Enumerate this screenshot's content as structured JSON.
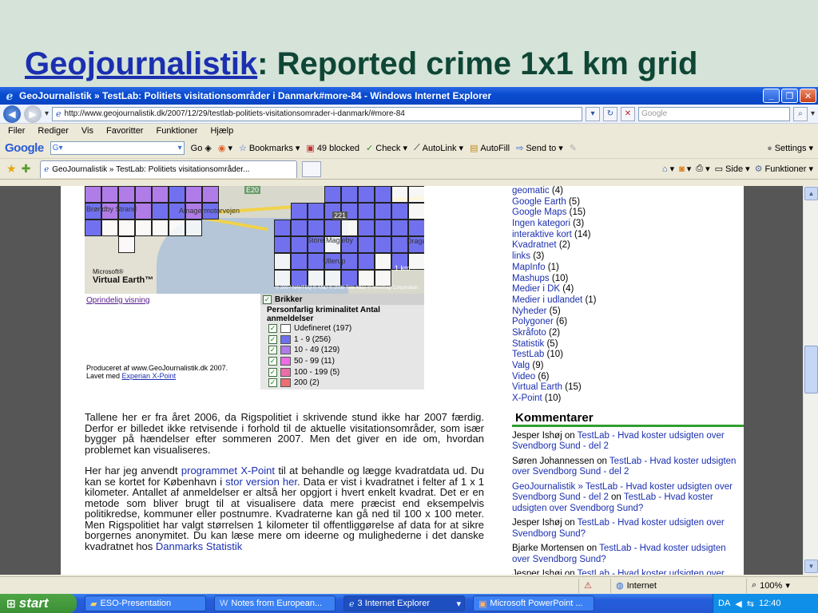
{
  "slide": {
    "title_link": "Geojournalistik",
    "title_rest": ": Reported crime 1x1 km grid"
  },
  "window": {
    "title": "GeoJournalistik » TestLab: Politiets visitationsområder i Danmark#more-84 - Windows Internet Explorer",
    "url": "http://www.geojournalistik.dk/2007/12/29/testlab-politiets-visitationsomrader-i-danmark/#more-84",
    "search_placeholder": "Google",
    "menu": [
      "Filer",
      "Rediger",
      "Vis",
      "Favoritter",
      "Funktioner",
      "Hjælp"
    ],
    "googlebar": {
      "logo": "Google",
      "go": "Go",
      "bookmarks": "Bookmarks",
      "blocked": "49 blocked",
      "check": "Check",
      "autolink": "AutoLink",
      "autofill": "AutoFill",
      "sendto": "Send to",
      "settings": "Settings"
    },
    "tab_label": "GeoJournalistik » TestLab: Politiets visitationsområder...",
    "toolbar": {
      "side": "Side",
      "funktioner": "Funktioner"
    },
    "status": {
      "zone": "Internet",
      "zoom": "100%"
    }
  },
  "map": {
    "labels": [
      "Brøndby Strand",
      "Amagermotorvejen",
      "Store Magleby",
      "Dragør",
      "Ullerup",
      "E20",
      "221"
    ],
    "brand_small": "Microsoft®",
    "brand": "Virtual Earth™",
    "copyright": "© 2007 NAVTEQ  © AND  © 2006 Tele Atlas  © Intermap Corporation",
    "scale": "1 km",
    "original_view": "Oprindelig visning",
    "legend_head": "Brikker",
    "legend_sub": "Personfarlig kriminalitet Antal anmeldelser",
    "legend_rows": [
      {
        "label": "Udefineret (197)",
        "color": "#ffffff"
      },
      {
        "label": "1 - 9 (256)",
        "color": "#6f6ff0"
      },
      {
        "label": "10 - 49 (129)",
        "color": "#b07ce8"
      },
      {
        "label": "50 - 99 (11)",
        "color": "#ee6ce8"
      },
      {
        "label": "100 - 199 (5)",
        "color": "#ec6ea8"
      },
      {
        "label": "200 (2)",
        "color": "#ec6e6e"
      }
    ],
    "produced_1": "Produceret af www.GeoJournalistik.dk 2007.",
    "produced_2": "Lavet med ",
    "produced_link": "Experian X-Point"
  },
  "article": {
    "p1": "Tallene her er fra året 2006, da Rigspolitiet i skrivende stund ikke har 2007 færdig. Derfor er billedet ikke retvisende i forhold til de aktuelle visitationsområder, som især bygger på hændelser efter sommeren 2007. Men det giver en ide om, hvordan problemet kan visualiseres.",
    "p2_a": "Her har jeg anvendt ",
    "p2_link1": "programmet X-Point",
    "p2_b": " til at behandle og lægge kvadratdata ud. Du kan se kortet for København i ",
    "p2_link2": "stor version her",
    "p2_c": ". Data er vist i kvadratnet i felter af 1 x 1 kilometer. Antallet af anmeldelser er altså her opgjort i hvert enkelt kvadrat. Det er en metode som bliver brugt til at visualisere data mere præcist end eksempelvis politikredse, kommuner eller postnumre. Kvadraterne kan gå ned til 100 x 100 meter. Men Rigspolitiet har valgt størrelsen 1 kilometer til offentliggørelse af data for at sikre borgernes anonymitet. Du kan læse mere om ideerne og mulighederne i det danske kvadratnet hos ",
    "p2_link3": "Danmarks Statistik"
  },
  "sidebar": {
    "categories": [
      {
        "name": "geomatic",
        "count": "(4)"
      },
      {
        "name": "Google Earth",
        "count": "(5)"
      },
      {
        "name": "Google Maps",
        "count": "(15)"
      },
      {
        "name": "Ingen kategori",
        "count": "(3)"
      },
      {
        "name": "interaktive kort",
        "count": "(14)"
      },
      {
        "name": "Kvadratnet",
        "count": "(2)"
      },
      {
        "name": "links",
        "count": "(3)"
      },
      {
        "name": "MapInfo",
        "count": "(1)"
      },
      {
        "name": "Mashups",
        "count": "(10)"
      },
      {
        "name": "Medier i DK",
        "count": "(4)"
      },
      {
        "name": "Medier i udlandet",
        "count": "(1)"
      },
      {
        "name": "Nyheder",
        "count": "(5)"
      },
      {
        "name": "Polygoner",
        "count": "(6)"
      },
      {
        "name": "Skråfoto",
        "count": "(2)"
      },
      {
        "name": "Statistik",
        "count": "(5)"
      },
      {
        "name": "TestLab",
        "count": "(10)"
      },
      {
        "name": "Valg",
        "count": "(9)"
      },
      {
        "name": "Video",
        "count": "(6)"
      },
      {
        "name": "Virtual Earth",
        "count": "(15)"
      },
      {
        "name": "X-Point",
        "count": "(10)"
      }
    ],
    "comments_title": "Kommentarer",
    "comments": [
      {
        "author": "Jesper Ishøj",
        "on": " on ",
        "post": "TestLab - Hvad koster udsigten over Svendborg Sund - del 2"
      },
      {
        "author": "Søren Johannessen",
        "on": " on ",
        "post": "TestLab - Hvad koster udsigten over Svendborg Sund - del 2"
      },
      {
        "author": "GeoJournalistik » TestLab - Hvad koster udsigten over Svendborg Sund - del 2",
        "on": " on ",
        "post": "TestLab - Hvad koster udsigten over Svendborg Sund?"
      },
      {
        "author": "Jesper Ishøj",
        "on": " on ",
        "post": "TestLab - Hvad koster udsigten over Svendborg Sund?"
      },
      {
        "author": "Bjarke Mortensen",
        "on": " on ",
        "post": "TestLab - Hvad koster udsigten over Svendborg Sund?"
      },
      {
        "author": "Jesper Ishøj",
        "on": " on ",
        "post": "TestLab - Hvad koster udsigten over Svendborg Sund?"
      }
    ]
  },
  "taskbar": {
    "start": "start",
    "tasks": [
      "ESO-Presentation",
      "Notes from European...",
      "3 Internet Explorer",
      "Microsoft PowerPoint ..."
    ],
    "lang": "DA",
    "time": "12:40"
  }
}
